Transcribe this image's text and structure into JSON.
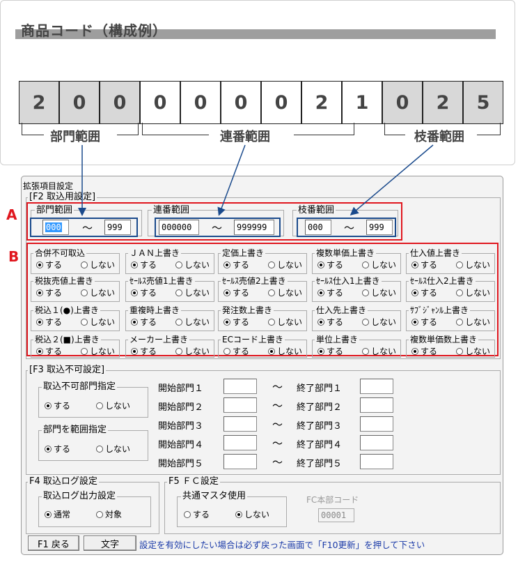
{
  "diagram": {
    "title": "商品コード（構成例）",
    "digits": [
      "2",
      "0",
      "0",
      "0",
      "0",
      "0",
      "0",
      "2",
      "1",
      "0",
      "2",
      "5"
    ],
    "groups": [
      "部門範囲",
      "連番範囲",
      "枝番範囲"
    ]
  },
  "panel": {
    "title": "拡張項目設定",
    "marker_a": "A",
    "marker_b": "B",
    "f2": {
      "title": "[F2 取込用設定]",
      "bumon": {
        "label": "部門範囲",
        "from": "000",
        "to": "999",
        "sep": "～"
      },
      "renban": {
        "label": "連番範囲",
        "from": "000000",
        "to": "999999",
        "sep": "～"
      },
      "edaban": {
        "label": "枝番範囲",
        "from": "000",
        "to": "999",
        "sep": "～"
      },
      "options_on": "する",
      "options_off": "しない",
      "overrides": [
        {
          "label": "合併不可取込",
          "selected": "on"
        },
        {
          "label": "ＪＡＮ上書き",
          "selected": "on"
        },
        {
          "label": "定価上書き",
          "selected": "on"
        },
        {
          "label": "複数単価上書き",
          "selected": "on"
        },
        {
          "label": "仕入値上書き",
          "selected": "on"
        },
        {
          "label": "税抜売値上書き",
          "selected": "on"
        },
        {
          "label": "ｾｰﾙｽ売値1上書き",
          "selected": "on"
        },
        {
          "label": "ｾｰﾙｽ売値2上書き",
          "selected": "on"
        },
        {
          "label": "ｾｰﾙｽ仕入1上書き",
          "selected": "on"
        },
        {
          "label": "ｾｰﾙｽ仕入2上書き",
          "selected": "on"
        },
        {
          "label": "税込１(●)上書き",
          "selected": "on"
        },
        {
          "label": "重複時上書き",
          "selected": "on"
        },
        {
          "label": "発注数上書き",
          "selected": "on"
        },
        {
          "label": "仕入先上書き",
          "selected": "on"
        },
        {
          "label": "ｻﾌﾞｼﾞｬﾝﾙ上書き",
          "selected": "on"
        },
        {
          "label": "税込２(■)上書き",
          "selected": "on"
        },
        {
          "label": "メーカー上書き",
          "selected": "on"
        },
        {
          "label": "ECコード上書き",
          "selected": "off"
        },
        {
          "label": "単位上書き",
          "selected": "on"
        },
        {
          "label": "複数単価数上書き",
          "selected": "on"
        }
      ]
    },
    "f3": {
      "title": "[F3 取込不可設定]",
      "dept_specify": {
        "label": "取込不可部門指定",
        "on": "する",
        "off": "しない"
      },
      "range_specify": {
        "label": "部門を範囲指定",
        "on": "する",
        "off": "しない"
      },
      "start_labels": [
        "開始部門１",
        "開始部門２",
        "開始部門３",
        "開始部門４",
        "開始部門５"
      ],
      "end_labels": [
        "終了部門１",
        "終了部門２",
        "終了部門３",
        "終了部門４",
        "終了部門５"
      ],
      "sep": "～"
    },
    "f4": {
      "title": "F4 取込ログ設定",
      "output": {
        "label": "取込ログ出力設定",
        "normal": "通常",
        "target": "対象"
      }
    },
    "f5": {
      "title": "F5 ＦＣ設定",
      "shared": {
        "label": "共通マスタ使用",
        "on": "する",
        "off": "しない"
      },
      "hq_code_label": "FC本部コード",
      "hq_code_value": "00001"
    },
    "footer": {
      "back_button": "F1 戻る",
      "char_button": "文字",
      "notice": "設定を有効にしたい場合は必ず戻った画面で「F10更新」を押して下さい"
    }
  },
  "colors": {
    "accent_blue": "#1a4a8c",
    "marker_red": "#e0161e",
    "selection": "#3399ff",
    "notice_text": "#1a3aa8"
  }
}
